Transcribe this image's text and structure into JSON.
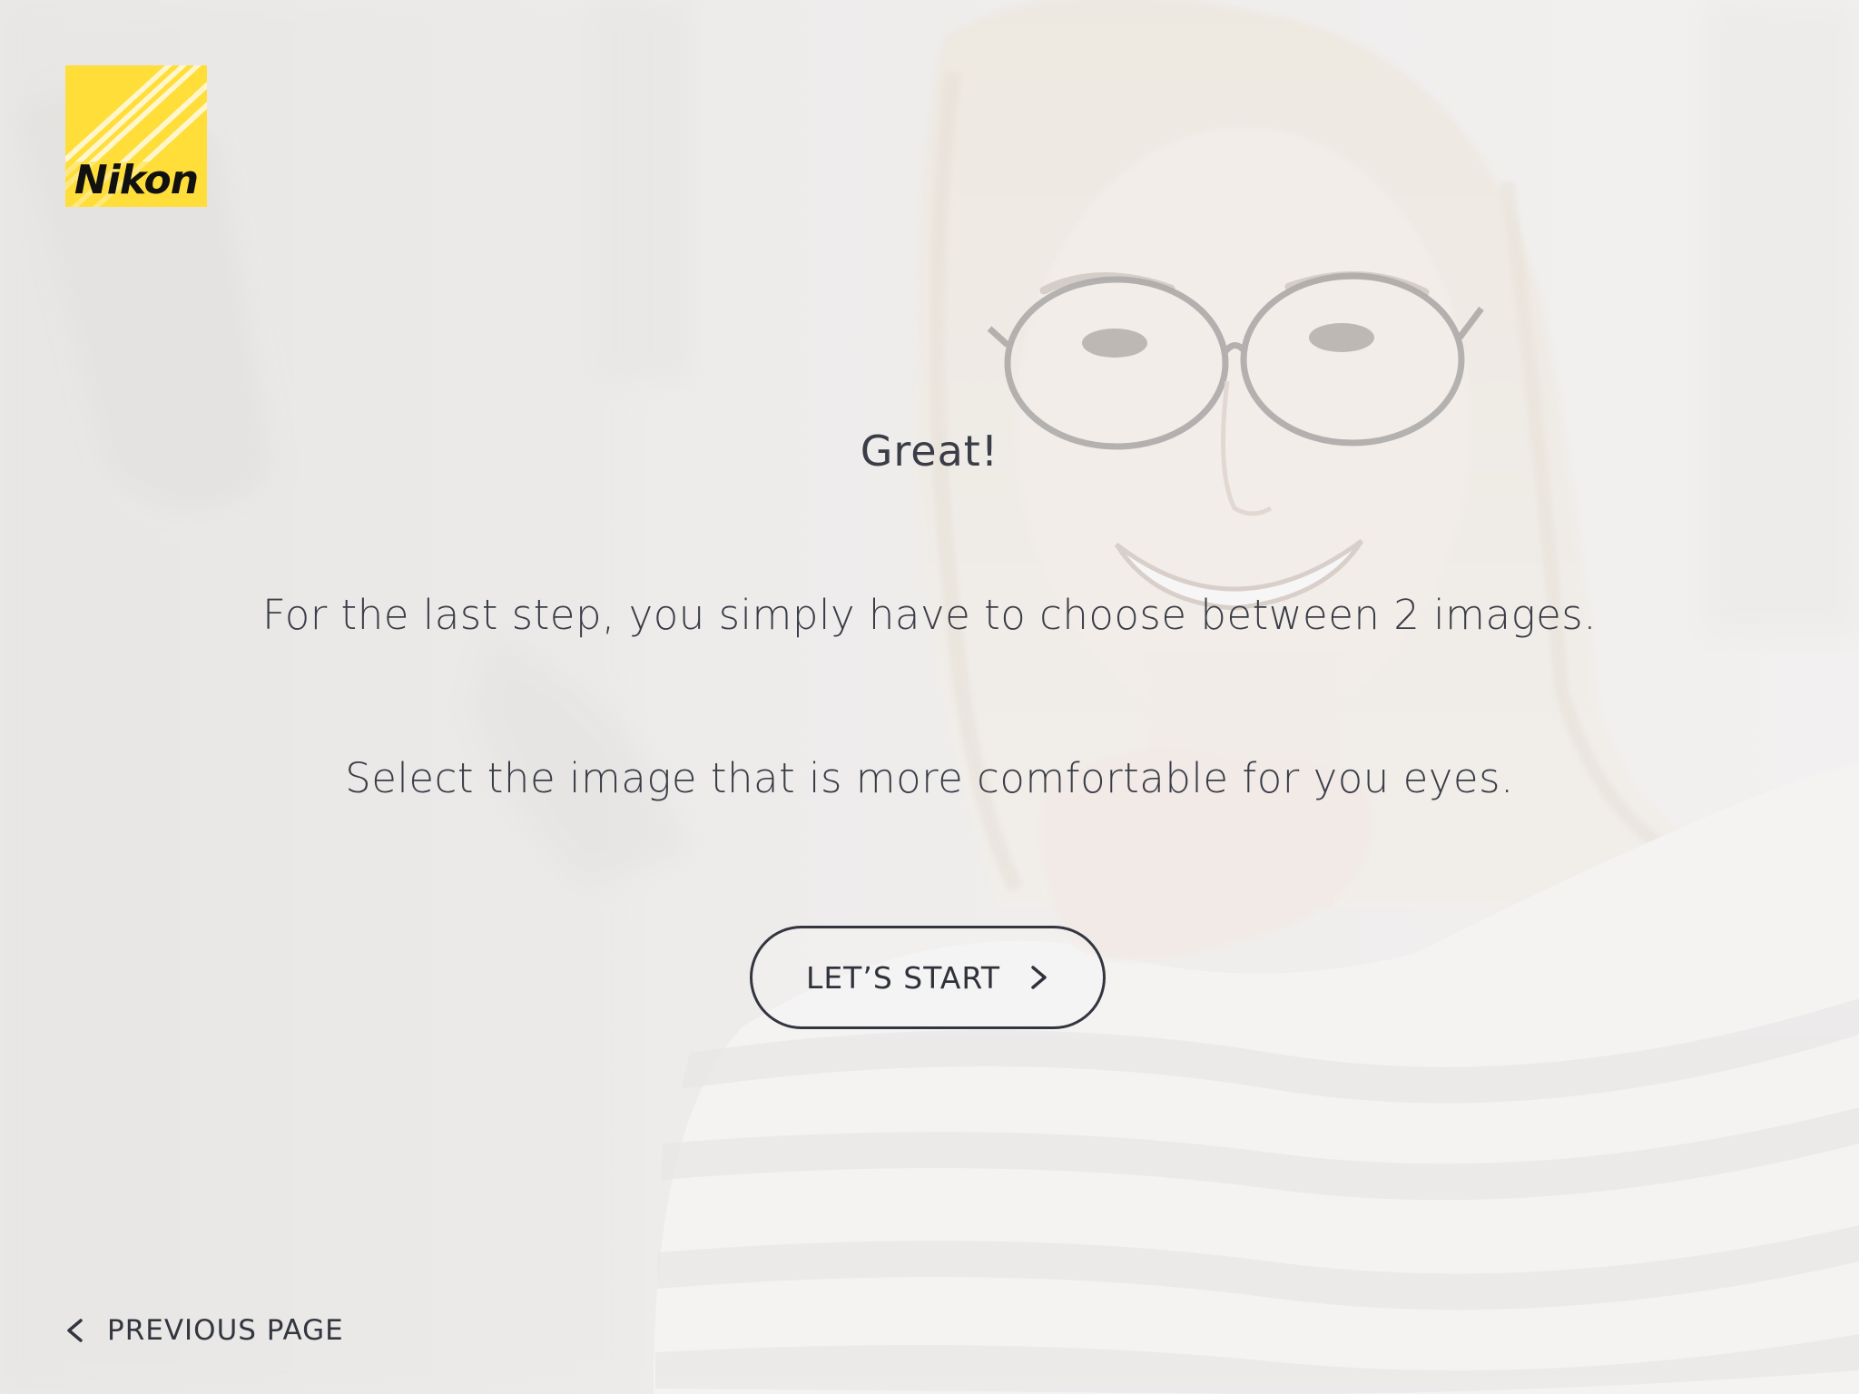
{
  "brand": {
    "logo_text": "Nikon",
    "logo_color": "#ffde3a"
  },
  "main": {
    "heading": "Great!",
    "line1": "For the last step, you simply have to choose between 2 images.",
    "line2": "Select the image that is more comfortable for you eyes."
  },
  "actions": {
    "start_label": "LET’S START",
    "start_icon": "chevron-right-icon",
    "previous_label": "PREVIOUS PAGE",
    "previous_icon": "chevron-left-icon"
  },
  "colors": {
    "text": "#3a3d47",
    "button_border": "#33363f",
    "background": "#ecebea"
  }
}
